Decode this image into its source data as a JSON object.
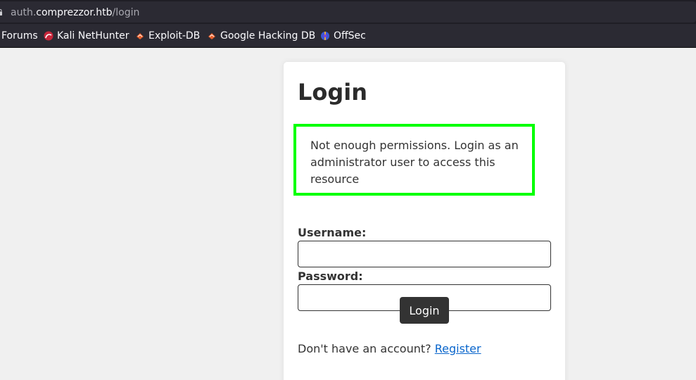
{
  "browser": {
    "url_prefix": "auth.",
    "url_host": "comprezzor.htb",
    "url_path": "/login",
    "bookmarks": [
      {
        "label": "Forums",
        "icon": "forums-icon"
      },
      {
        "label": "Kali NetHunter",
        "icon": "kali-nethunter-icon"
      },
      {
        "label": "Exploit-DB",
        "icon": "exploit-db-icon"
      },
      {
        "label": "Google Hacking DB",
        "icon": "google-hacking-db-icon"
      },
      {
        "label": "OffSec",
        "icon": "offsec-icon"
      }
    ]
  },
  "login": {
    "title": "Login",
    "alert": "Not enough permissions. Login as an administrator user to access this resource",
    "username_label": "Username:",
    "username_value": "",
    "password_label": "Password:",
    "password_value": "",
    "submit_label": "Login",
    "register_prompt": "Don't have an account?",
    "register_link": "Register"
  },
  "colors": {
    "alert_border": "#00ff00",
    "button_bg": "#333333",
    "link": "#0a66cc"
  }
}
